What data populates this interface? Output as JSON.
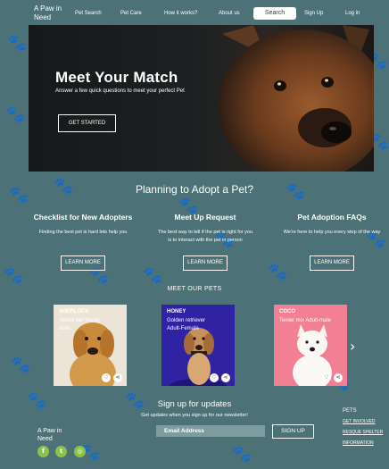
{
  "header": {
    "logo": "A Paw in Need",
    "nav": [
      "Pet Search",
      "Pet Care",
      "How it works?",
      "About us"
    ],
    "search_label": "Search",
    "sign_up": "Sign Up",
    "log_in": "Log in"
  },
  "hero": {
    "title": "Meet Your Match",
    "subtitle": "Answer a few quick questions to meet your perfect Pet",
    "cta": "GET STARTED"
  },
  "planning": {
    "title": "Planning to Adopt a Pet?",
    "columns": [
      {
        "title": "Checklist for New Adopters",
        "text": "Finding the best pet is hard lets help you",
        "button": "LEARN MORE"
      },
      {
        "title": "Meet Up Request",
        "text": "The best way to tell if the pet is right for you is to interact with the pet in person",
        "button": "LEARN MORE"
      },
      {
        "title": "Pet Adoption FAQs",
        "text": "We're here to help you every step of the way",
        "button": "LEARN MORE"
      }
    ]
  },
  "pets": {
    "title": "MEET OUR PETS",
    "cards": [
      {
        "name": "SHERLOCK",
        "desc": "Yellow lab Young-male"
      },
      {
        "name": "HONEY",
        "desc": "Golden retriever Adult-Female"
      },
      {
        "name": "COCO",
        "desc": "Terrier mix Adult-male"
      }
    ],
    "heart_icon": "heart-icon",
    "share_icon": "share-icon",
    "next_icon": "chevron-right-icon"
  },
  "signup": {
    "title": "Sign up for updates",
    "text": "Get updates when you sign up for our newsletter!",
    "placeholder": "Email Address",
    "button": "SIGN UP"
  },
  "footer": {
    "logo": "A Paw in Need",
    "social": [
      {
        "name": "facebook-icon",
        "glyph": "f"
      },
      {
        "name": "twitter-icon",
        "glyph": "t"
      },
      {
        "name": "instagram-icon",
        "glyph": "◎"
      }
    ],
    "links_heading": "PETS",
    "links": [
      "GET INVOLVED",
      "RESQUE SHELTER",
      "INFORMATION"
    ]
  },
  "colors": {
    "background": "#4c7277",
    "social": "#8bc34a",
    "input": "#7c9ca0"
  }
}
